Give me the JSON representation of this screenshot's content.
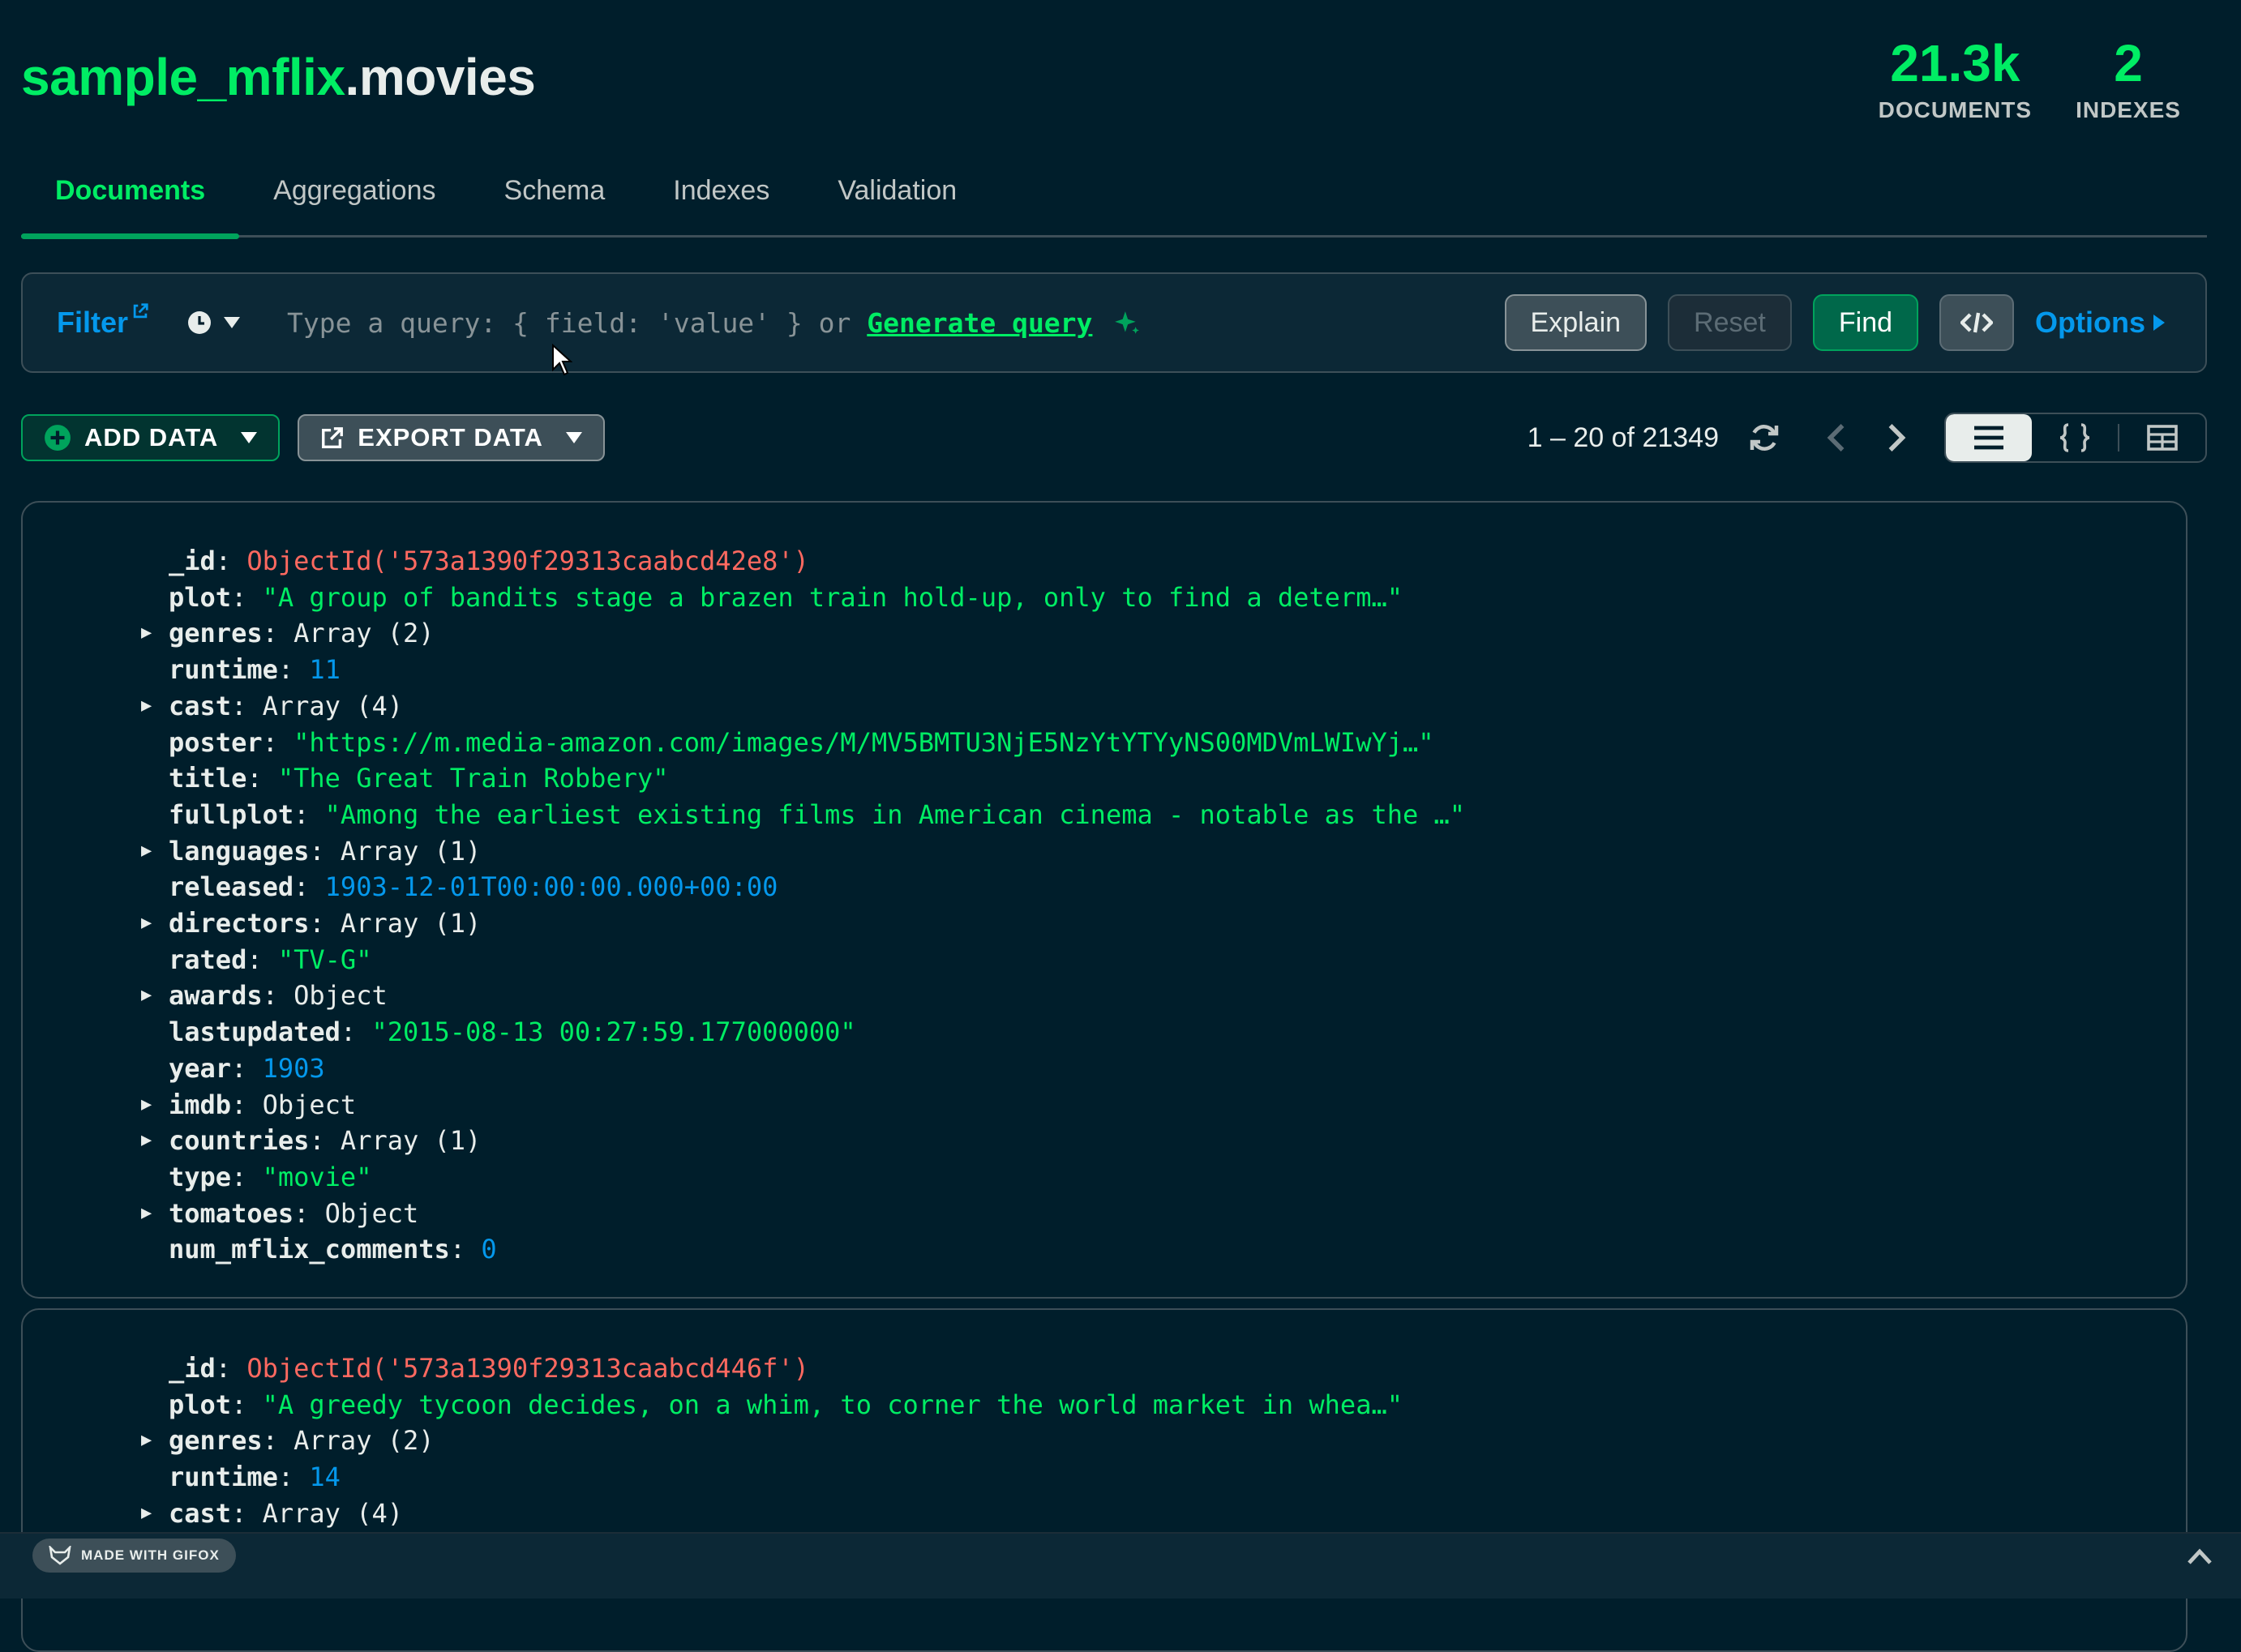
{
  "header": {
    "db": "sample_mflix",
    "collection": ".movies"
  },
  "stats": [
    {
      "value": "21.3k",
      "label": "DOCUMENTS"
    },
    {
      "value": "2",
      "label": "INDEXES"
    }
  ],
  "tabs": [
    {
      "label": "Documents",
      "active": true
    },
    {
      "label": "Aggregations"
    },
    {
      "label": "Schema"
    },
    {
      "label": "Indexes"
    },
    {
      "label": "Validation"
    }
  ],
  "querybar": {
    "filter_label": "Filter",
    "placeholder": "Type a query: { field: 'value' } or ",
    "generate_label": "Generate query",
    "explain_label": "Explain",
    "reset_label": "Reset",
    "find_label": "Find",
    "options_label": "Options"
  },
  "toolbar": {
    "add_label": "ADD DATA",
    "export_label": "EXPORT DATA",
    "range_text": "1 – 20 of 21349"
  },
  "documents": [
    {
      "fields": [
        {
          "key": "_id",
          "value": "ObjectId('573a1390f29313caabcd42e8')",
          "type": "oid",
          "expandable": false
        },
        {
          "key": "plot",
          "value": "\"A group of bandits stage a brazen train hold-up, only to find a determ…\"",
          "type": "str",
          "expandable": false
        },
        {
          "key": "genres",
          "value": "Array (2)",
          "type": "plain",
          "expandable": true
        },
        {
          "key": "runtime",
          "value": "11",
          "type": "num",
          "expandable": false
        },
        {
          "key": "cast",
          "value": "Array (4)",
          "type": "plain",
          "expandable": true
        },
        {
          "key": "poster",
          "value": "\"https://m.media-amazon.com/images/M/MV5BMTU3NjE5NzYtYTYyNS00MDVmLWIwYj…\"",
          "type": "str",
          "expandable": false
        },
        {
          "key": "title",
          "value": "\"The Great Train Robbery\"",
          "type": "str",
          "expandable": false
        },
        {
          "key": "fullplot",
          "value": "\"Among the earliest existing films in American cinema - notable as the …\"",
          "type": "str",
          "expandable": false
        },
        {
          "key": "languages",
          "value": "Array (1)",
          "type": "plain",
          "expandable": true
        },
        {
          "key": "released",
          "value": "1903-12-01T00:00:00.000+00:00",
          "type": "num",
          "expandable": false
        },
        {
          "key": "directors",
          "value": "Array (1)",
          "type": "plain",
          "expandable": true
        },
        {
          "key": "rated",
          "value": "\"TV-G\"",
          "type": "str",
          "expandable": false
        },
        {
          "key": "awards",
          "value": "Object",
          "type": "plain",
          "expandable": true
        },
        {
          "key": "lastupdated",
          "value": "\"2015-08-13 00:27:59.177000000\"",
          "type": "str",
          "expandable": false
        },
        {
          "key": "year",
          "value": "1903",
          "type": "num",
          "expandable": false
        },
        {
          "key": "imdb",
          "value": "Object",
          "type": "plain",
          "expandable": true
        },
        {
          "key": "countries",
          "value": "Array (1)",
          "type": "plain",
          "expandable": true
        },
        {
          "key": "type",
          "value": "\"movie\"",
          "type": "str",
          "expandable": false
        },
        {
          "key": "tomatoes",
          "value": "Object",
          "type": "plain",
          "expandable": true
        },
        {
          "key": "num_mflix_comments",
          "value": "0",
          "type": "num",
          "expandable": false
        }
      ]
    },
    {
      "fields": [
        {
          "key": "_id",
          "value": "ObjectId('573a1390f29313caabcd446f')",
          "type": "oid",
          "expandable": false
        },
        {
          "key": "plot",
          "value": "\"A greedy tycoon decides, on a whim, to corner the world market in whea…\"",
          "type": "str",
          "expandable": false
        },
        {
          "key": "genres",
          "value": "Array (2)",
          "type": "plain",
          "expandable": true
        },
        {
          "key": "runtime",
          "value": "14",
          "type": "num",
          "expandable": false
        },
        {
          "key": "cast",
          "value": "Array (4)",
          "type": "plain",
          "expandable": true
        }
      ]
    }
  ],
  "footer": {
    "badge": "MADE WITH GIFOX"
  },
  "colors": {
    "accent_green": "#00ed64",
    "link_blue": "#0498ec",
    "objectid_red": "#ff6960",
    "background": "#001e2b"
  }
}
